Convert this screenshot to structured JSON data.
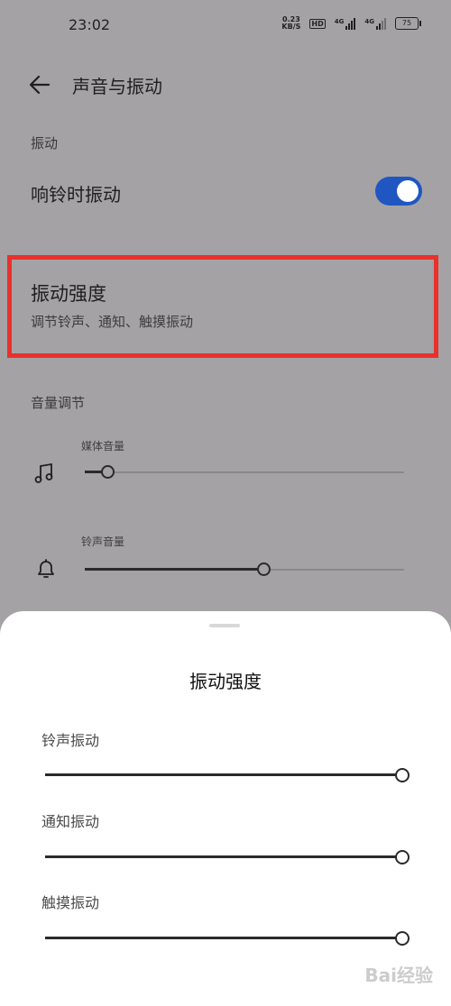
{
  "status_bar": {
    "time": "23:02",
    "speed_value": "0.23",
    "speed_unit": "KB/S",
    "hd": "HD",
    "sim1": "4G",
    "sim2": "4G",
    "battery": "75"
  },
  "header": {
    "title": "声音与振动",
    "back_icon": "back-arrow-icon"
  },
  "vibration_section": {
    "heading": "振动",
    "ring_vibrate_label": "响铃时振动",
    "ring_vibrate_on": true,
    "intensity_title": "振动强度",
    "intensity_subtitle": "调节铃声、通知、触摸振动"
  },
  "volume_section": {
    "heading": "音量调节",
    "media": {
      "label": "媒体音量",
      "icon": "music-note-icon",
      "level": 0.07
    },
    "ringtone": {
      "label": "铃声音量",
      "icon": "bell-icon",
      "level": 0.56
    }
  },
  "sheet": {
    "title": "振动强度",
    "items": [
      {
        "label": "铃声振动",
        "level": 1.0
      },
      {
        "label": "通知振动",
        "level": 1.0
      },
      {
        "label": "触摸振动",
        "level": 1.0
      }
    ]
  },
  "watermark": "Bai经验",
  "colors": {
    "accent": "#1f56c2",
    "highlight_box": "#e8312c",
    "dim_overlay": "#a4a2a4"
  }
}
